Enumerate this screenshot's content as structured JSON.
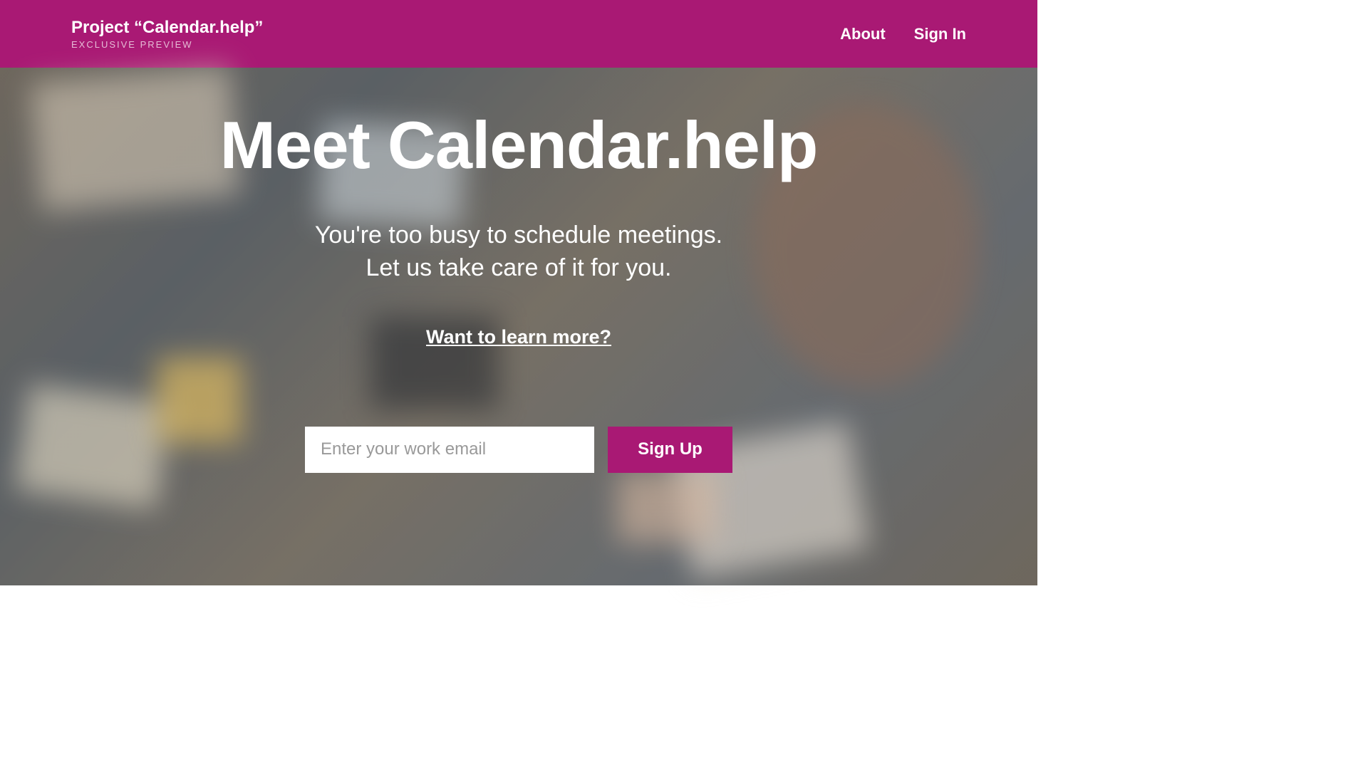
{
  "header": {
    "project_title": "Project “Calendar.help”",
    "subtitle": "EXCLUSIVE PREVIEW",
    "nav": {
      "about": "About",
      "sign_in": "Sign In"
    }
  },
  "hero": {
    "title": "Meet Calendar.help",
    "subtitle_line1": "You're too busy to schedule meetings.",
    "subtitle_line2": "Let us take care of it for you.",
    "learn_more": "Want to learn more?",
    "email_placeholder": "Enter your work email",
    "signup_button": "Sign Up"
  },
  "colors": {
    "brand": "#a91974"
  }
}
